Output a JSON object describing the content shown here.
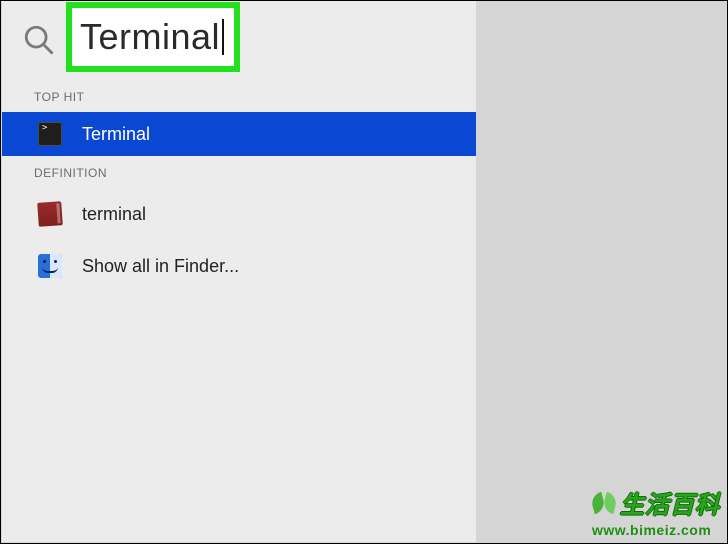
{
  "search": {
    "query": "Terminal"
  },
  "sections": {
    "top_hit": {
      "header": "TOP HIT",
      "item_label": "Terminal"
    },
    "definition": {
      "header": "DEFINITION",
      "dictionary_label": "terminal",
      "show_all_label": "Show all in Finder..."
    }
  },
  "watermark": {
    "title": "生活百科",
    "url": "www.bimeiz.com"
  }
}
